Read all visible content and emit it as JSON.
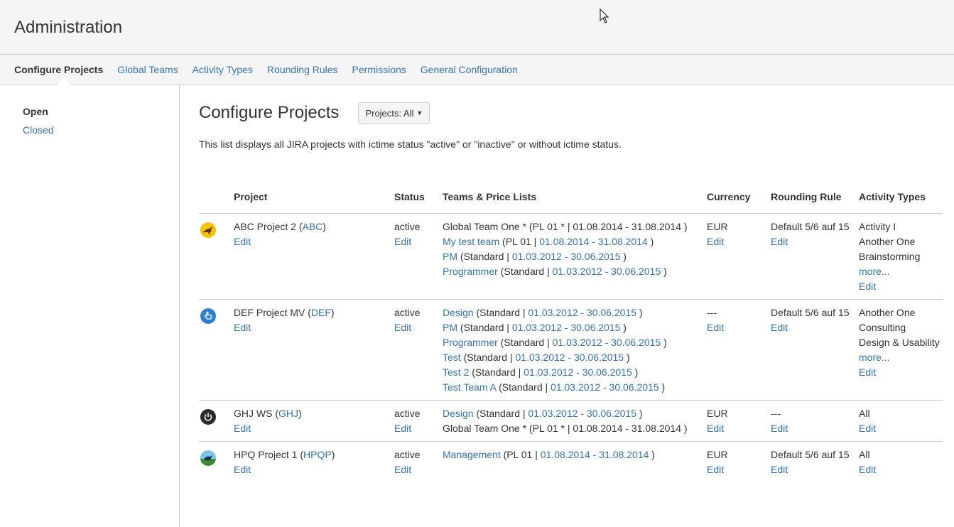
{
  "header": {
    "title": "Administration"
  },
  "tabs": [
    "Configure Projects",
    "Global Teams",
    "Activity Types",
    "Rounding Rules",
    "Permissions",
    "General Configuration"
  ],
  "sidebar": {
    "items": [
      "Open",
      "Closed"
    ]
  },
  "main": {
    "title": "Configure Projects",
    "filter_label": "Projects: All",
    "description": "This list displays all JIRA projects with ictime status \"active\" or \"inactive\" or without ictime status."
  },
  "table": {
    "headers": {
      "project": "Project",
      "status": "Status",
      "teams": "Teams & Price Lists",
      "currency": "Currency",
      "rounding": "Rounding Rule",
      "activity": "Activity Types"
    },
    "rows": [
      {
        "icon": "kangaroo-icon",
        "name": "ABC Project 2",
        "key": "ABC",
        "edit": "Edit",
        "status": "active",
        "status_edit": "Edit",
        "teams": [
          {
            "team": "Global Team One *",
            "team_link": false,
            "pl": "PL 01 *",
            "dates": "01.08.2014 - 31.08.2014",
            "dates_link": false
          },
          {
            "team": "My test team",
            "team_link": true,
            "pl": "PL 01",
            "dates": "01.08.2014 - 31.08.2014",
            "dates_link": true
          },
          {
            "team": "PM",
            "team_link": true,
            "pl": "Standard",
            "dates": "01.03.2012 - 30.06.2015",
            "dates_link": true
          },
          {
            "team": "Programmer",
            "team_link": true,
            "pl": "Standard",
            "dates": "01.03.2012 - 30.06.2015",
            "dates_link": true
          }
        ],
        "currency": "EUR",
        "currency_edit": "Edit",
        "rounding": "Default 5/6 auf 15",
        "rounding_edit": "Edit",
        "activities": [
          "Activity I",
          "Another One",
          "Brainstorming"
        ],
        "more": "more...",
        "activity_edit": "Edit"
      },
      {
        "icon": "hand-pointer-icon",
        "name": "DEF Project MV",
        "key": "DEF",
        "edit": "Edit",
        "status": "active",
        "status_edit": "Edit",
        "teams": [
          {
            "team": "Design",
            "team_link": true,
            "pl": "Standard",
            "dates": "01.03.2012 - 30.06.2015",
            "dates_link": true
          },
          {
            "team": "PM",
            "team_link": true,
            "pl": "Standard",
            "dates": "01.03.2012 - 30.06.2015",
            "dates_link": true
          },
          {
            "team": "Programmer",
            "team_link": true,
            "pl": "Standard",
            "dates": "01.03.2012 - 30.06.2015",
            "dates_link": true
          },
          {
            "team": "Test",
            "team_link": true,
            "pl": "Standard",
            "dates": "01.03.2012 - 30.06.2015",
            "dates_link": true
          },
          {
            "team": "Test 2",
            "team_link": true,
            "pl": "Standard",
            "dates": "01.03.2012 - 30.06.2015",
            "dates_link": true
          },
          {
            "team": "Test Team A",
            "team_link": true,
            "pl": "Standard",
            "dates": "01.03.2012 - 30.06.2015",
            "dates_link": true
          }
        ],
        "currency": "---",
        "currency_edit": "Edit",
        "rounding": "Default 5/6 auf 15",
        "rounding_edit": "Edit",
        "activities": [
          "Another One",
          "Consulting",
          "Design & Usability"
        ],
        "more": "more...",
        "activity_edit": "Edit"
      },
      {
        "icon": "power-icon",
        "name": "GHJ WS",
        "key": "GHJ",
        "edit": "Edit",
        "status": "active",
        "status_edit": "Edit",
        "teams": [
          {
            "team": "Design",
            "team_link": true,
            "pl": "Standard",
            "dates": "01.03.2012 - 30.06.2015",
            "dates_link": true
          },
          {
            "team": "Global Team One *",
            "team_link": false,
            "pl": "PL 01 *",
            "dates": "01.08.2014 - 31.08.2014",
            "dates_link": false
          }
        ],
        "currency": "EUR",
        "currency_edit": "Edit",
        "rounding": "---",
        "rounding_edit": "Edit",
        "activities": [
          "All"
        ],
        "more": "",
        "activity_edit": "Edit"
      },
      {
        "icon": "bird-icon",
        "name": "HPQ Project 1",
        "key": "HPQP",
        "edit": "Edit",
        "status": "active",
        "status_edit": "Edit",
        "teams": [
          {
            "team": "Management",
            "team_link": true,
            "pl": "PL 01",
            "dates": "01.08.2014 - 31.08.2014",
            "dates_link": true
          }
        ],
        "currency": "EUR",
        "currency_edit": "Edit",
        "rounding": "Default 5/6 auf 15",
        "rounding_edit": "Edit",
        "activities": [
          "All"
        ],
        "more": "",
        "activity_edit": "Edit"
      }
    ]
  }
}
